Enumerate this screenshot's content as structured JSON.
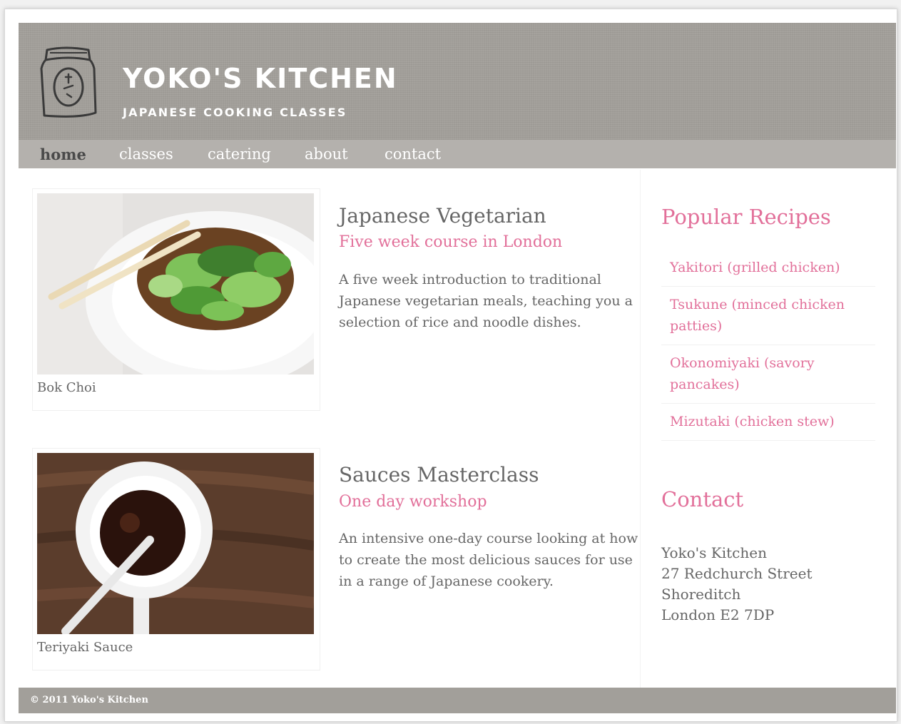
{
  "header": {
    "title": "YOKO'S KITCHEN",
    "subtitle": "JAPANESE COOKING CLASSES",
    "logo_icon": "rice-bag-icon"
  },
  "nav": {
    "items": [
      {
        "label": "home",
        "active": true
      },
      {
        "label": "classes",
        "active": false
      },
      {
        "label": "catering",
        "active": false
      },
      {
        "label": "about",
        "active": false
      },
      {
        "label": "contact",
        "active": false
      }
    ]
  },
  "main": {
    "articles": [
      {
        "image_caption": "Bok Choi",
        "title": "Japanese Vegetarian",
        "subtitle": "Five week course in London",
        "description": "A five week introduction to traditional Japanese vegetarian meals, teaching you a selection of rice and noodle dishes."
      },
      {
        "image_caption": "Teriyaki Sauce",
        "title": "Sauces Masterclass",
        "subtitle": "One day workshop",
        "description": "An intensive one-day course looking at how to create the most delicious sauces for use in a range of Japanese cookery."
      }
    ]
  },
  "sidebar": {
    "recipes_heading": "Popular Recipes",
    "recipes": [
      "Yakitori (grilled chicken)",
      "Tsukune (minced chicken patties)",
      "Okonomiyaki (savory pancakes)",
      "Mizutaki (chicken stew)"
    ],
    "contact_heading": "Contact",
    "address": [
      "Yoko's Kitchen",
      "27 Redchurch Street",
      "Shoreditch",
      "London E2 7DP"
    ]
  },
  "footer": {
    "text": "© 2011 Yoko's Kitchen"
  },
  "colors": {
    "accent_pink": "#e2709a",
    "header_gray": "#a29f9a",
    "nav_gray": "#b4b1ad"
  }
}
